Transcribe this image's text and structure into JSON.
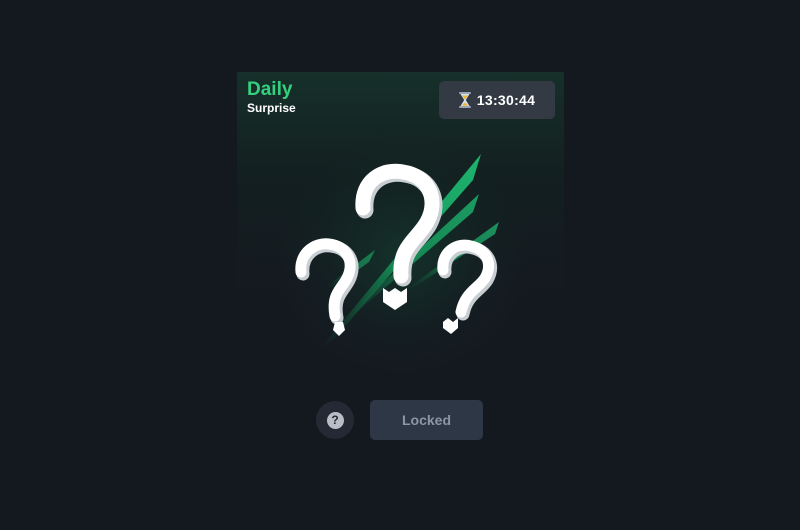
{
  "card": {
    "title": "Daily",
    "subtitle": "Surprise",
    "timer": {
      "icon": "hourglass-icon",
      "value": "13:30:44"
    },
    "illustration": "mystery-question-marks"
  },
  "controls": {
    "help_icon": "question-circle-icon",
    "help_glyph": "?",
    "locked_label": "Locked"
  },
  "colors": {
    "background": "#141920",
    "accent": "#35d07f",
    "timer_bg": "#343a44",
    "button_bg": "#2d3745"
  }
}
